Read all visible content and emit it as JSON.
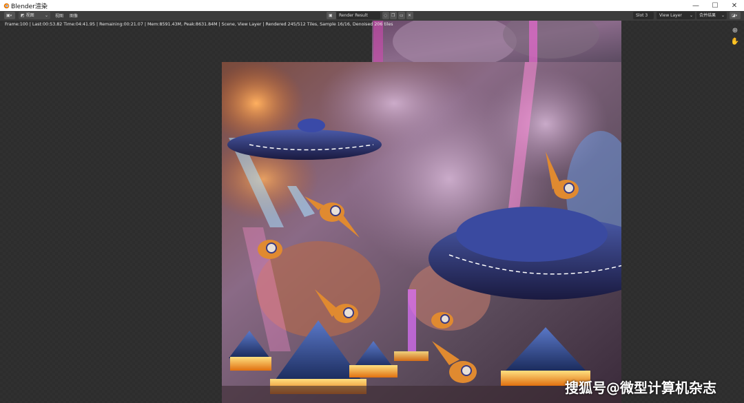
{
  "window": {
    "title": "Blender渲染",
    "controls": {
      "minimize": "—",
      "maximize": "☐",
      "close": "✕"
    }
  },
  "header": {
    "editor_type_icon": "image-editor-icon",
    "mode_label": "视图",
    "menu": [
      {
        "label": "视图"
      },
      {
        "label": "图像"
      }
    ],
    "image_name": "Render Result",
    "slot": "Slot 3",
    "view_layer": "View Layer",
    "pass": "合并结果"
  },
  "status": {
    "stats": "Frame:100 | Last:00:53.82 Time:04:41.95 | Remaining:00:21.07 | Mem:8591.43M, Peak:8631.84M | Scene, View Layer | Rendered 245/512 Tiles, Sample 16/16, Denoised 206 tiles"
  },
  "tools": [
    {
      "icon": "zoom-icon"
    },
    {
      "icon": "hand-icon"
    }
  ],
  "watermark": "搜狐号@微型计算机杂志",
  "colors": {
    "header_bg": "#3c3c3c",
    "accent": "#e87d0d",
    "viewport_bg": "#2d2d2d"
  }
}
